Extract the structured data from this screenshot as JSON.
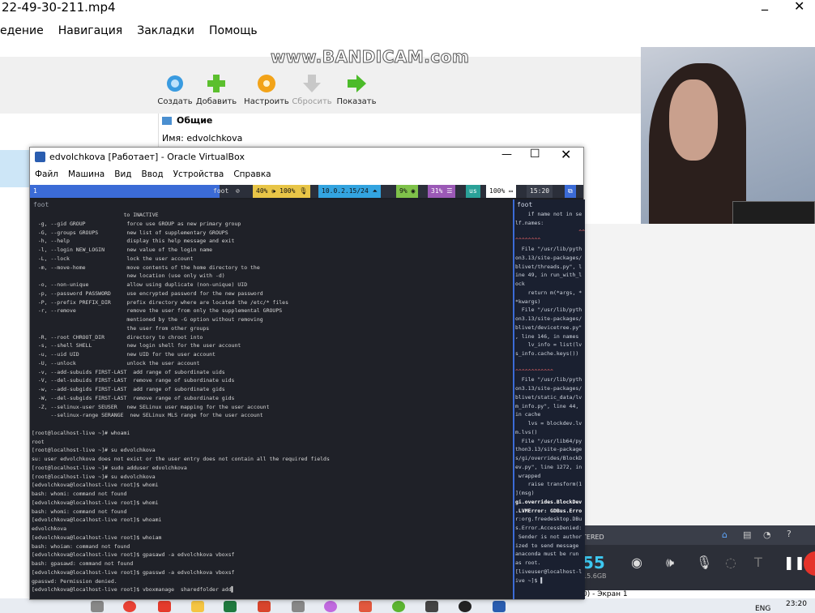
{
  "host": {
    "title": "22-49-30-211.mp4",
    "min_glyph": "_",
    "close_glyph": "✕",
    "menu": [
      "едение",
      "Навигация",
      "Закладки",
      "Помощь"
    ]
  },
  "watermark": "www.BANDICAM.com",
  "vbox_manager": {
    "toolbar": [
      {
        "label": "Создать",
        "icon": "gear-icon",
        "color": "#3a9be0",
        "disabled": false
      },
      {
        "label": "Добавить",
        "icon": "plus-icon",
        "color": "#5bbf2e",
        "disabled": false
      },
      {
        "label": "Настроить",
        "icon": "settings-icon",
        "color": "#f2a319",
        "disabled": false
      },
      {
        "label": "Сбросить",
        "icon": "arrow-down-icon",
        "color": "#c8c8c8",
        "disabled": true
      },
      {
        "label": "Показать",
        "icon": "arrow-right-icon",
        "color": "#4cbb2a",
        "disabled": false
      }
    ],
    "details_header": "Общие",
    "details_name": "Имя:   edvolchkova"
  },
  "vbox_window": {
    "title": "edvolchkova [Работает] - Oracle VirtualBox",
    "menu": [
      "Файл",
      "Машина",
      "Вид",
      "Ввод",
      "Устройства",
      "Справка"
    ]
  },
  "waybar": {
    "workspace": "1",
    "app": "foot",
    "volume": "40% 🕪 100% 🎙",
    "network": "10.0.2.15/24 ⏶",
    "cpu": "9% ◉",
    "mem": "31% ☰",
    "lang": "us",
    "battery": "100% ▭",
    "time": "15:20",
    "accent_colors": [
      "#3b6bd6",
      "#e8c547",
      "#33a4e0",
      "#7fc24a",
      "#9b59b6",
      "#2aa198"
    ]
  },
  "terminal_main": {
    "tab": "foot",
    "lines": [
      "                             to INACTIVE",
      "  -g, --gid GROUP             force use GROUP as new primary group",
      "  -G, --groups GROUPS         new list of supplementary GROUPS",
      "  -h, --help                  display this help message and exit",
      "  -l, --login NEW_LOGIN       new value of the login name",
      "  -L, --lock                  lock the user account",
      "  -m, --move-home             move contents of the home directory to the",
      "                              new location (use only with -d)",
      "  -o, --non-unique            allow using duplicate (non-unique) UID",
      "  -p, --password PASSWORD     use encrypted password for the new password",
      "  -P, --prefix PREFIX_DIR     prefix directory where are located the /etc/* files",
      "  -r, --remove                remove the user from only the supplemental GROUPS",
      "                              mentioned by the -G option without removing",
      "                              the user from other groups",
      "  -R, --root CHROOT_DIR       directory to chroot into",
      "  -s, --shell SHELL           new login shell for the user account",
      "  -u, --uid UID               new UID for the user account",
      "  -U, --unlock                unlock the user account",
      "  -v, --add-subuids FIRST-LAST  add range of subordinate uids",
      "  -V, --del-subuids FIRST-LAST  remove range of subordinate uids",
      "  -w, --add-subgids FIRST-LAST  add range of subordinate gids",
      "  -W, --del-subgids FIRST-LAST  remove range of subordinate gids",
      "  -Z, --selinux-user SEUSER   new SELinux user mapping for the user account",
      "      --selinux-range SERANGE  new SELinux MLS range for the user account",
      "",
      "[root@localhost-live ~]# whoami",
      "root",
      "[root@localhost-live ~]# su edvolchkova",
      "su: user edvolchkova does not exist or the user entry does not contain all the required fields",
      "[root@localhost-live ~]# sudo adduser edvolchkova",
      "[root@localhost-live ~]# su edvolchkova",
      "[edvolchkova@localhost-live root]$ whomi",
      "bash: whomi: command not found",
      "[edvolchkova@localhost-live root]$ whomi",
      "bash: whomi: command not found",
      "[edvolchkova@localhost-live root]$ whoami",
      "edvolchkova",
      "[edvolchkova@localhost-live root]$ whoiam",
      "bash: whoiam: command not found",
      "[edvolchkova@localhost-live root]$ gpasawd -a edvolchkova vboxsf",
      "bash: gpasawd: command not found",
      "[edvolchkova@localhost-live root]$ gpasswd -a edvolchkova vboxsf",
      "gpasswd: Permission denied.",
      "[edvolchkova@localhost-live root]$ vboxmanage  sharedfolder add▌"
    ]
  },
  "terminal_side": {
    "tab": "foot",
    "lines": [
      "    if name not in se",
      "lf.names:",
      "                    ^^",
      "^^^^^^^^",
      "  File \"/usr/lib/pyth",
      "on3.13/site-packages/",
      "blivet/threads.py\", l",
      "ine 49, in run_with_l",
      "ock",
      "    return m(*args, *",
      "*kwargs)",
      "  File \"/usr/lib/pyth",
      "on3.13/site-packages/",
      "blivet/devicetree.py\"",
      ", line 146, in names",
      "    lv_info = list(lv",
      "s_info.cache.keys())",
      "",
      "^^^^^^^^^^^^",
      "  File \"/usr/lib/pyth",
      "on3.13/site-packages/",
      "blivet/static_data/lv",
      "m_info.py\", line 44,",
      "in cache",
      "    lvs = blockdev.lv",
      "m.lvs()",
      "  File \"/usr/lib64/py",
      "thon3.13/site-package",
      "s/gi/overrides/BlockD",
      "ev.py\", line 1272, in",
      " wrapped",
      "    raise transform(1",
      "](msg)",
      "gi.overrides.BlockDev",
      ".LVMError: GDBus.Erro",
      "r:org.freedesktop.DBu",
      "s.Error.AccessDenied:",
      " Sender is not author",
      "ized to send message",
      "anaconda must be run",
      "as root.",
      "[liveuser@localhost-l",
      "ive ~]$ ▌"
    ]
  },
  "recorder": {
    "status": "TERED",
    "elapsed": "55",
    "size": "15.6GB",
    "screen_label": "0) - Экран 1"
  },
  "taskbar": {
    "lang": "ENG",
    "time": "23:20"
  }
}
